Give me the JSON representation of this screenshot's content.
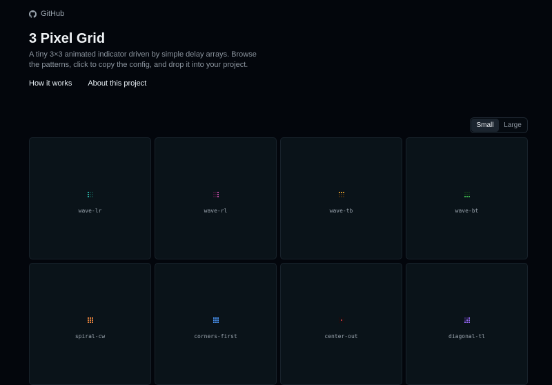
{
  "header": {
    "github_label": "GitHub",
    "title": "3 Pixel Grid",
    "description": "A tiny 3×3 animated indicator driven by simple delay arrays. Browse the patterns, click to copy the config, and drop it into your project."
  },
  "nav": {
    "how_it_works": "How it works",
    "about": "About this project"
  },
  "size_toggle": {
    "options": [
      "Small",
      "Large"
    ],
    "selected": "Small"
  },
  "patterns": [
    {
      "name": "wave-lr",
      "color": "#2bb5a8",
      "dim": "#0f3d3a",
      "on": [
        1,
        0,
        0,
        1,
        0,
        0,
        1,
        0,
        0
      ]
    },
    {
      "name": "wave-rl",
      "color": "#c24fa8",
      "dim": "#3d1736",
      "on": [
        0,
        0,
        1,
        0,
        0,
        1,
        0,
        0,
        1
      ]
    },
    {
      "name": "wave-tb",
      "color": "#d99a2b",
      "dim": "#3d2b0f",
      "on": [
        1,
        1,
        1,
        0,
        0,
        0,
        0,
        0,
        0
      ]
    },
    {
      "name": "wave-bt",
      "color": "#3fb950",
      "dim": "#113318",
      "on": [
        0,
        0,
        0,
        0,
        0,
        0,
        1,
        1,
        1
      ]
    },
    {
      "name": "spiral-cw",
      "color": "#f0883e",
      "dim": "#7a4216",
      "on": [
        1,
        1,
        1,
        1,
        1,
        1,
        1,
        1,
        1
      ]
    },
    {
      "name": "corners-first",
      "color": "#4d9bff",
      "dim": "#1d4a86",
      "on": [
        1,
        1,
        1,
        1,
        1,
        1,
        1,
        1,
        1
      ]
    },
    {
      "name": "center-out",
      "color": "#c0393d",
      "dim": "#1a0d0f",
      "on": [
        0,
        0,
        0,
        0,
        1,
        0,
        0,
        0,
        0
      ]
    },
    {
      "name": "diagonal-tl",
      "color": "#9a6bff",
      "dim": "#3a2a6a",
      "on": [
        0,
        0,
        1,
        0,
        1,
        1,
        1,
        1,
        1
      ]
    }
  ]
}
